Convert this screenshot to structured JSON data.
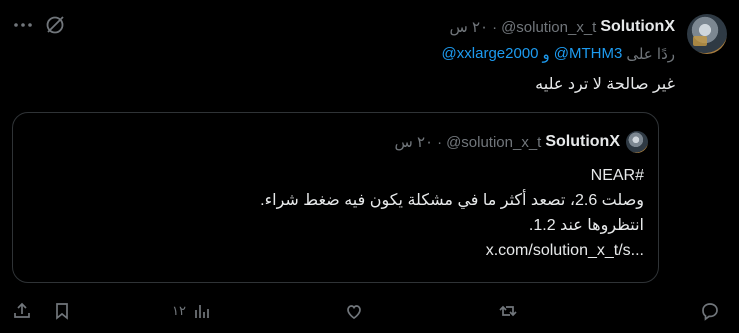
{
  "tweet": {
    "author_name": "SolutionX",
    "handle": "@solution_x_t",
    "separator": "·",
    "time": "٢٠ س",
    "reply_prefix": "ردًا على",
    "mention_1": "@MTHM3",
    "mention_joiner": "و",
    "mention_2": "@xxlarge2000",
    "text": "غير صالحة لا ترد عليه"
  },
  "quote": {
    "author_name": "SolutionX",
    "handle": "@solution_x_t",
    "separator": "·",
    "time": "٢٠ س",
    "lines": [
      "#NEAR",
      "وصلت 2.6، تصعد أكثر ما في مشكلة يكون فيه ضغط شراء.",
      "انتظروها عند 1.2.",
      "x.com/solution_x_t/s..."
    ]
  },
  "actions": {
    "views_count": "١٢"
  },
  "icons": {
    "more": "more-horizontal-icon",
    "grok": "grok-icon",
    "reply": "reply-icon",
    "retweet": "retweet-icon",
    "like": "like-icon",
    "views": "views-icon",
    "bookmark": "bookmark-icon",
    "share": "share-icon"
  },
  "colors": {
    "background": "#000000",
    "text": "#e7e9ea",
    "muted": "#71767b",
    "link": "#1d9bf0",
    "border": "#2f3336"
  }
}
